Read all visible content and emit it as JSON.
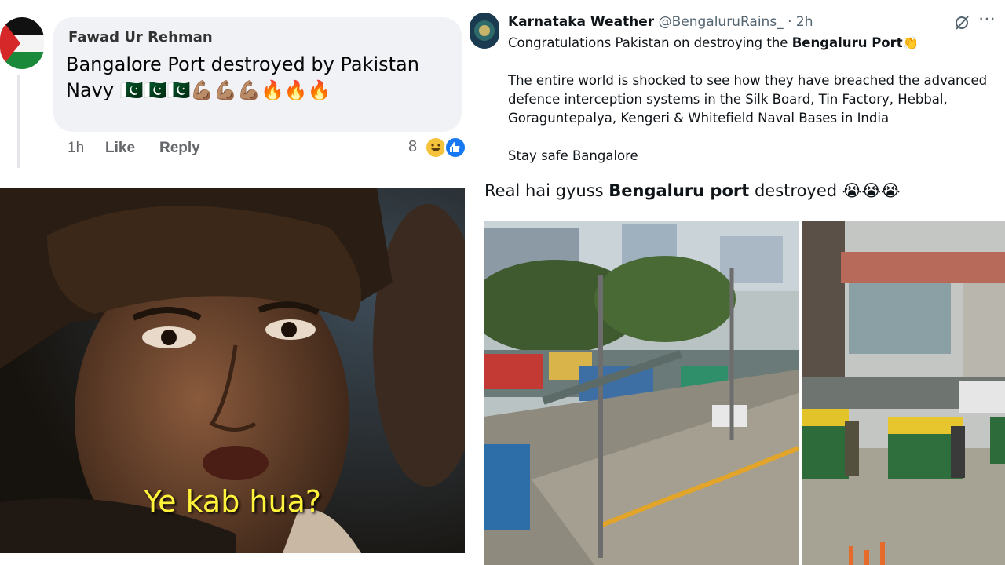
{
  "fb_comment": {
    "author": "Fawad Ur Rehman",
    "text": "Bangalore Port destroyed by Pakistan Navy 🇵🇰🇵🇰🇵🇰💪🏽💪🏽💪🏽🔥🔥🔥",
    "time": "1h",
    "like_label": "Like",
    "reply_label": "Reply",
    "reaction_count": "8",
    "reactions": [
      "haha-icon",
      "like-icon"
    ]
  },
  "meme": {
    "caption": "Ye kab hua?"
  },
  "tweet": {
    "name": "Karnataka Weather",
    "handle": "@BengaluruRains_",
    "separator": "·",
    "time": "2h",
    "line1_prefix": "Congratulations Pakistan on destroying the ",
    "line1_bold": "Bengaluru Port",
    "line1_emoji": "👏",
    "paragraph2": "The entire world is shocked to see how they have breached the advanced defence interception systems in the Silk Board, Tin Factory, Hebbal, Goraguntepalya, Kengeri & Whitefield Naval Bases in India",
    "paragraph3": "Stay safe Bangalore"
  },
  "reply": {
    "prefix": "Real hai gyuss ",
    "bold": "Bengaluru port",
    "suffix": " destroyed ",
    "emoji": "😭😭😭"
  },
  "colors": {
    "fb_bubble": "#f0f2f5",
    "fb_meta": "#65676b",
    "meme_caption": "#fff23a",
    "twitter_dim": "#536471",
    "fb_like_blue": "#1877f2"
  }
}
